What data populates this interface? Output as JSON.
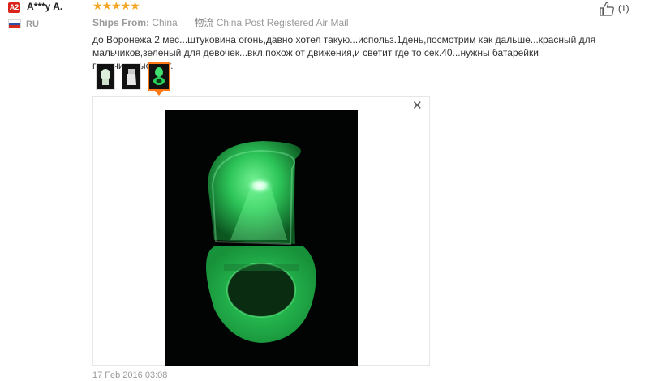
{
  "reviewer": {
    "level_badge": "A2",
    "name": "A***y A.",
    "country": "RU"
  },
  "rating": {
    "stars_glyphs": "★★★★★",
    "value": 5,
    "max": 5,
    "color": "#f5a623"
  },
  "shipping": {
    "ships_from_label": "Ships From:",
    "ships_from_value": "China",
    "logistics_label": "物流",
    "logistics_value": "China Post Registered Air Mail"
  },
  "review_text": "до Воронежа 2 мес...штуковина огонь,давно хотел такую...использ.1день,посмотрим как дальше...красный для мальчиков,зеленый для девочек...вкл.похож от движения,и светит где то сек.40...нужны батарейки пальчиковые,2шт.",
  "helpful": {
    "count_label": "(1)",
    "icon": "thumbs-up-icon"
  },
  "thumbnails": [
    {
      "name": "photo-thumbnail-1",
      "active": false
    },
    {
      "name": "photo-thumbnail-2",
      "active": false
    },
    {
      "name": "photo-thumbnail-3",
      "active": true
    }
  ],
  "viewer": {
    "close_glyph": "✕"
  },
  "review_date": "17 Feb 2016 03:08",
  "colors": {
    "badge": "#d9241c",
    "accent_orange": "#ff7a16",
    "glow_green": "#35e86a"
  }
}
